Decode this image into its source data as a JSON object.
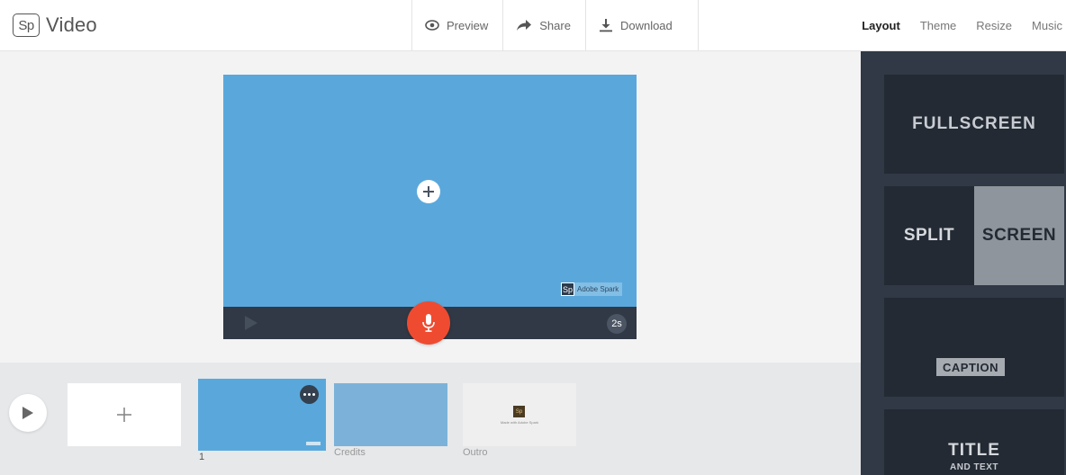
{
  "header": {
    "logo_text": "Sp",
    "app_name": "Video",
    "toolbar": [
      {
        "icon": "eye-icon",
        "label": "Preview"
      },
      {
        "icon": "share-arrow-icon",
        "label": "Share"
      },
      {
        "icon": "download-icon",
        "label": "Download"
      }
    ],
    "nav": [
      {
        "label": "Layout",
        "active": true
      },
      {
        "label": "Theme",
        "active": false
      },
      {
        "label": "Resize",
        "active": false
      },
      {
        "label": "Music",
        "active": false
      }
    ]
  },
  "stage": {
    "watermark_logo": "Sp",
    "watermark_text": "Adobe Spark",
    "duration": "2s"
  },
  "timeline": {
    "slides": [
      {
        "label": "1"
      },
      {
        "label": "Credits"
      },
      {
        "label": "Outro"
      }
    ],
    "outro_logo": "Sp",
    "outro_caption": "Made with Adobe Spark"
  },
  "layouts": {
    "fullscreen": "FULLSCREEN",
    "split_left": "SPLIT",
    "split_right": "SCREEN",
    "caption": "CAPTION",
    "title_main": "TITLE",
    "title_sub": "AND TEXT"
  },
  "colors": {
    "canvas": "#5aa8db",
    "record": "#ef4b31",
    "panel": "#303945",
    "card": "#232a33"
  }
}
